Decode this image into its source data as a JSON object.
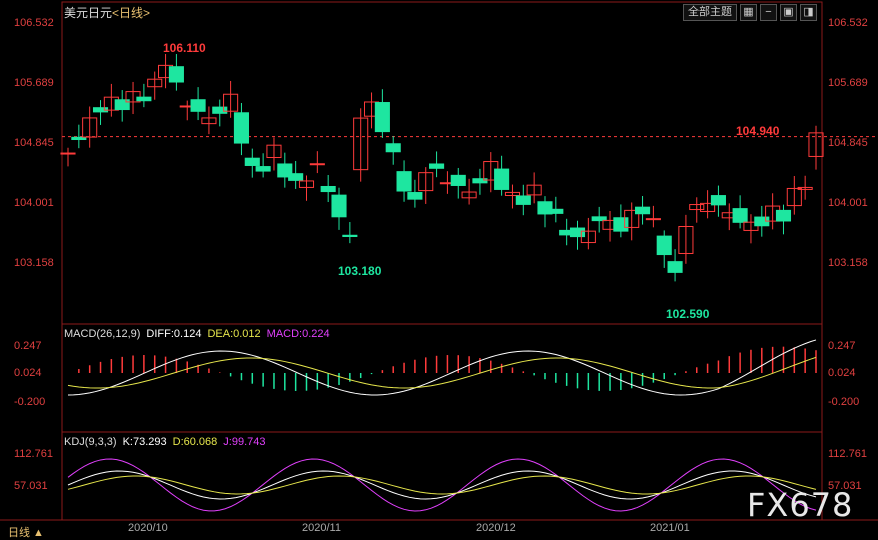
{
  "header": {
    "symbol": "美元日元",
    "period": "<日线>",
    "theme_button": "全部主题"
  },
  "toolbar_icons": [
    "grid-icon",
    "minus-icon",
    "crosshair-icon",
    "settings-icon"
  ],
  "price_ticks": [
    "106.532",
    "105.689",
    "104.845",
    "104.001",
    "103.158"
  ],
  "macd_header": {
    "name": "MACD(26,12,9)",
    "diff": "DIFF:0.124",
    "dea": "DEA:0.012",
    "macd": "MACD:0.224"
  },
  "macd_ticks": [
    "0.247",
    "0.024",
    "-0.200"
  ],
  "kdj_header": {
    "name": "KDJ(9,3,3)",
    "k": "K:73.293",
    "d": "D:60.068",
    "j": "J:99.743"
  },
  "kdj_ticks": [
    "112.761",
    "57.031"
  ],
  "x_labels": [
    "2020/10",
    "2020/11",
    "2020/12",
    "2021/01"
  ],
  "footer_period": "日线",
  "annotations": {
    "high": "106.110",
    "low1": "103.180",
    "low2": "102.590",
    "last": "104.940"
  },
  "watermark": "FX678",
  "colors": {
    "up": "#ff3b3b",
    "down": "#1ee6a0",
    "diff": "#ffffff",
    "dea": "#e6e64c",
    "j": "#e040fb",
    "grid": "#8b1a1a"
  },
  "chart_data": {
    "type": "candlestick",
    "last_price": 104.845,
    "price_range": [
      102.4,
      106.532
    ],
    "high_marker": 106.11,
    "low_markers": [
      103.18,
      102.59
    ],
    "last_marker": 104.94
  }
}
